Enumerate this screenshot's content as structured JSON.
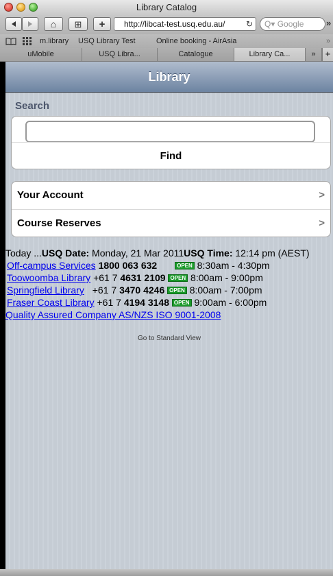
{
  "window": {
    "title": "Library Catalog"
  },
  "toolbar": {
    "back_icon": "back-arrow-icon",
    "forward_icon": "forward-arrow-icon",
    "home_glyph": "⌂",
    "bookmark_glyph": "⊞",
    "add_glyph": "+",
    "url": "http://libcat-test.usq.edu.au/",
    "reload_glyph": "↻",
    "search_placeholder": "Q▾ Google",
    "overflow_glyph": "»"
  },
  "bookmarks": [
    "m.library",
    "USQ Library Test",
    "Online booking - AirAsia"
  ],
  "bookmarks_overflow": "»",
  "tabs": [
    {
      "label": "uMobile",
      "active": false
    },
    {
      "label": "USQ Libra...",
      "active": false
    },
    {
      "label": "Catalogue",
      "active": false
    },
    {
      "label": "Library Ca...",
      "active": true
    }
  ],
  "tabs_overflow": "»",
  "tabs_add": "+",
  "page": {
    "title": "Library",
    "search_label": "Search",
    "search_value": "",
    "find_label": "Find",
    "menu": [
      {
        "label": "Your Account",
        "chevron": ">"
      },
      {
        "label": "Course Reserves",
        "chevron": ">"
      }
    ],
    "today": {
      "prefix": "Today ...",
      "date_label": "USQ Date:",
      "date_value": " Monday, 21 Mar 2011",
      "time_label": "USQ Time:",
      "time_value": " 12:14 pm (AEST)"
    },
    "services": [
      {
        "name": "Off-campus Services",
        "phone_prefix": "",
        "phone_bold": "1800 063 632",
        "status": "OPEN",
        "hours": "8:30am - 4:30pm"
      },
      {
        "name": "Toowoomba Library",
        "phone_prefix": "+61 7 ",
        "phone_bold": "4631 2109",
        "status": "OPEN",
        "hours": "8:00am - 9:00pm"
      },
      {
        "name": "Springfield Library",
        "phone_prefix": "+61 7 ",
        "phone_bold": "3470 4246",
        "status": "OPEN",
        "hours": "8:00am - 7:00pm"
      },
      {
        "name": "Fraser Coast Library",
        "phone_prefix": "+61 7 ",
        "phone_bold": "4194 3148",
        "status": "OPEN",
        "hours": "9:00am - 6:00pm"
      }
    ],
    "quality_link": "Quality Assured Company AS/NZS ISO 9001-2008",
    "standard_view": "Go to Standard View"
  },
  "colors": {
    "header_gradient_top": "#b0bccd",
    "header_gradient_bottom": "#6d84a2",
    "page_background": "#c5ccd4",
    "open_badge": "#1a9a2a",
    "link": "#0000ee"
  }
}
